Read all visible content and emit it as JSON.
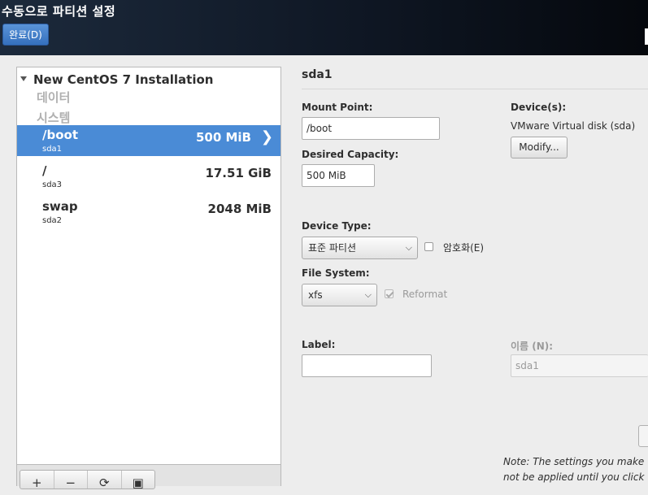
{
  "header": {
    "title": "수동으로 파티션 설정",
    "done_label": "완료(D)"
  },
  "tree": {
    "root_label": "New CentOS 7 Installation",
    "groups": [
      "데이터",
      "시스템"
    ],
    "partitions": [
      {
        "name": "/boot",
        "device": "sda1",
        "size": "500 MiB",
        "selected": true
      },
      {
        "name": "/",
        "device": "sda3",
        "size": "17.51 GiB",
        "selected": false
      },
      {
        "name": "swap",
        "device": "sda2",
        "size": "2048 MiB",
        "selected": false
      }
    ],
    "toolbar": {
      "add": "+",
      "remove": "−",
      "refresh": "⟳",
      "config": "▣"
    }
  },
  "detail": {
    "title": "sda1",
    "mount_point_label": "Mount Point:",
    "mount_point_value": "/boot",
    "desired_capacity_label": "Desired Capacity:",
    "desired_capacity_value": "500 MiB",
    "devices_label": "Device(s):",
    "device_name": "VMware Virtual disk (sda)",
    "modify_label": "Modify...",
    "device_type_label": "Device Type:",
    "device_type_value": "표준 파티션",
    "encrypt_label": "암호화(E)",
    "encrypt_checked": false,
    "file_system_label": "File System:",
    "file_system_value": "xfs",
    "reformat_label": "Reformat",
    "reformat_checked": true,
    "label_label": "Label:",
    "label_value": "",
    "name_label": "이름 (N):",
    "name_value": "sda1",
    "note_line1": "Note:  The settings you make",
    "note_line2": "not be applied until you click"
  },
  "icons": {
    "chevron": "chevron-right-icon",
    "expander": "triangle-down-icon",
    "combo_arrow": "chevron-down-icon"
  }
}
